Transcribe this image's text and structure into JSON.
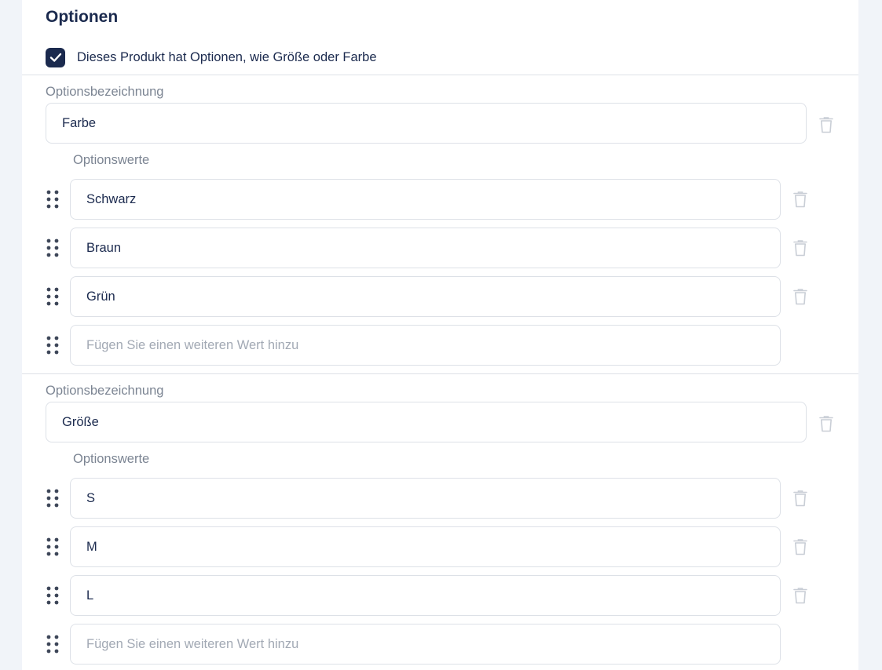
{
  "section": {
    "title": "Optionen",
    "has_options_label": "Dieses Produkt hat Optionen, wie Größe oder Farbe",
    "has_options_checked": true
  },
  "options": [
    {
      "name_label": "Optionsbezeichnung",
      "name_value": "Farbe",
      "values_label": "Optionswerte",
      "values": [
        "Schwarz",
        "Braun",
        "Grün"
      ],
      "new_value_placeholder": "Fügen Sie einen weiteren Wert hinzu"
    },
    {
      "name_label": "Optionsbezeichnung",
      "name_value": "Größe",
      "values_label": "Optionswerte",
      "values": [
        "S",
        "M",
        "L"
      ],
      "new_value_placeholder": "Fügen Sie einen weiteren Wert hinzu"
    }
  ],
  "icons": {
    "checkbox": "check-icon",
    "delete": "trash-icon",
    "drag": "drag-handle-icon"
  },
  "colors": {
    "primary": "#1b2a4e",
    "label": "#7c8593",
    "placeholder": "#a2a9b4",
    "border": "#dde1e7",
    "background": "#f1f4f9"
  }
}
